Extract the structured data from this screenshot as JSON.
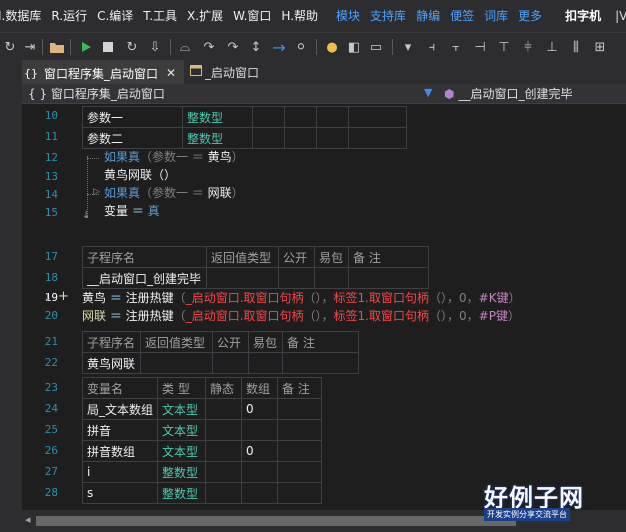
{
  "menubar": {
    "items": [
      "Ⅰ.数据库",
      "R.运行",
      "C.编译",
      "T.工具",
      "X.扩展",
      "W.窗口",
      "H.帮助"
    ],
    "links": [
      "模块",
      "支持库",
      "静编",
      "便签",
      "词库",
      "更多"
    ],
    "app_title": "扣字机",
    "window_glyph": "|V"
  },
  "tabs": [
    {
      "label": "窗口程序集_启动窗口",
      "prefix": "{}",
      "close": "✕",
      "active": true
    },
    {
      "label": "_启动窗口",
      "active": false
    }
  ],
  "navbar": {
    "left": "{ } 窗口程序集_启动窗口",
    "right": "__启动窗口_创建完毕"
  },
  "lines": {
    "n10": "10",
    "n11": "11",
    "n12": "12",
    "n13": "13",
    "n14": "14",
    "n15": "15",
    "n17": "17",
    "n18": "18",
    "n19": "19",
    "n20": "20",
    "n21": "21",
    "n22": "22",
    "n23": "23",
    "n24": "24",
    "n25": "25",
    "n26": "26",
    "n27": "27",
    "n28": "28"
  },
  "params_table": {
    "rows": [
      {
        "name": "参数一",
        "type": "整数型"
      },
      {
        "name": "参数二",
        "type": "整数型"
      }
    ]
  },
  "code": {
    "l12_kw": "如果真",
    "l12_rest_a": "（参数一 ＝ ",
    "l12_val": "黄鸟",
    "l12_close": "）",
    "l13": "黄鸟网联（）",
    "l14_kw": "如果真",
    "l14_rest_a": "（参数一 ＝ ",
    "l14_val": "网联",
    "l14_close": "）",
    "l15_var": "变量",
    "l15_eq": " ＝ ",
    "l15_val": "真",
    "l19_var": "黄鸟",
    "l19_eq": " ＝ ",
    "l19_fn": "注册热键",
    "l19_p1": "（",
    "l19_a1": "_启动窗口.取窗口句柄",
    "l19_p2": "（），",
    "l19_a2": "标签1.取窗口句柄",
    "l19_p3": "（），",
    "l19_n": "0",
    "l19_c": "，",
    "l19_k": "#K键",
    "l19_end": "）",
    "l20_var": "网联",
    "l20_eq": " ＝ ",
    "l20_fn": "注册热键",
    "l20_p1": "（",
    "l20_a1": "_启动窗口.取窗口句柄",
    "l20_p2": "（），",
    "l20_a2": "标签1.取窗口句柄",
    "l20_p3": "（），",
    "l20_n": "0",
    "l20_c": "，",
    "l20_k": "#P键",
    "l20_end": "）"
  },
  "sub1_table": {
    "headers": [
      "子程序名",
      "返回值类型",
      "公开",
      "易包",
      "备 注"
    ],
    "name": "__启动窗口_创建完毕"
  },
  "sub2_table": {
    "headers": [
      "子程序名",
      "返回值类型",
      "公开",
      "易包",
      "备 注"
    ],
    "name": "黄鸟网联"
  },
  "var_table": {
    "headers": [
      "变量名",
      "类 型",
      "静态",
      "数组",
      "备 注"
    ],
    "rows": [
      {
        "name": "局_文本数组",
        "type": "文本型",
        "array": "0"
      },
      {
        "name": "拼音",
        "type": "文本型",
        "array": ""
      },
      {
        "name": "拼音数组",
        "type": "文本型",
        "array": "0"
      },
      {
        "name": "i",
        "type": "整数型",
        "array": ""
      },
      {
        "name": "s",
        "type": "整数型",
        "array": ""
      }
    ]
  },
  "watermark": {
    "logo": "好例子网",
    "sub": "开发实例分享交流平台"
  },
  "colors": {
    "background": "#1e1e1e",
    "keyword": "#569cd6",
    "type": "#4ec9b0",
    "string": "#f44747",
    "constant": "#c586c0",
    "line_number": "#2b91af",
    "menu_link": "#4aa3ff"
  }
}
